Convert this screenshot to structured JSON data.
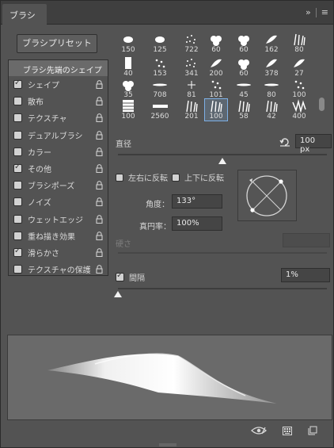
{
  "panel": {
    "tab_title": "ブラシ",
    "expand_glyph": "»",
    "menu_glyph": "≡"
  },
  "preset_button": "ブラシプリセット",
  "options_header": "ブラシ先端のシェイプ",
  "options": [
    {
      "label": "シェイプ",
      "checked": true
    },
    {
      "label": "散布",
      "checked": false
    },
    {
      "label": "テクスチャ",
      "checked": false
    },
    {
      "label": "デュアルブラシ",
      "checked": false
    },
    {
      "label": "カラー",
      "checked": false
    },
    {
      "label": "その他",
      "checked": true
    },
    {
      "label": "ブラシポーズ",
      "checked": false
    },
    {
      "label": "ノイズ",
      "checked": false
    },
    {
      "label": "ウェットエッジ",
      "checked": false
    },
    {
      "label": "重ね描き効果",
      "checked": false
    },
    {
      "label": "滑らかさ",
      "checked": true
    },
    {
      "label": "テクスチャの保護",
      "checked": false
    }
  ],
  "brush_sizes": [
    [
      "150",
      "125",
      "722",
      "60",
      "60",
      "162",
      "80"
    ],
    [
      "40",
      "153",
      "341",
      "200",
      "60",
      "378",
      "27"
    ],
    [
      "35",
      "708",
      "81",
      "101",
      "45",
      "80",
      "100"
    ],
    [
      "100",
      "2560",
      "201",
      "100",
      "58",
      "42",
      "400"
    ]
  ],
  "selected_brush": {
    "row": 3,
    "col": 3
  },
  "diameter": {
    "label": "直径",
    "value": "100 px",
    "percent": 0.5
  },
  "flip": {
    "x_label": "左右に反転",
    "y_label": "上下に反転"
  },
  "angle": {
    "label": "角度：",
    "value": "133°"
  },
  "roundness": {
    "label": "真円率：",
    "value": "100%"
  },
  "hardness": {
    "label": "硬さ"
  },
  "spacing": {
    "label": "間隔",
    "value": "1%",
    "checked": true
  },
  "icons": [
    "eye-toggle-icon",
    "grid-panel-icon",
    "new-brush-icon"
  ]
}
